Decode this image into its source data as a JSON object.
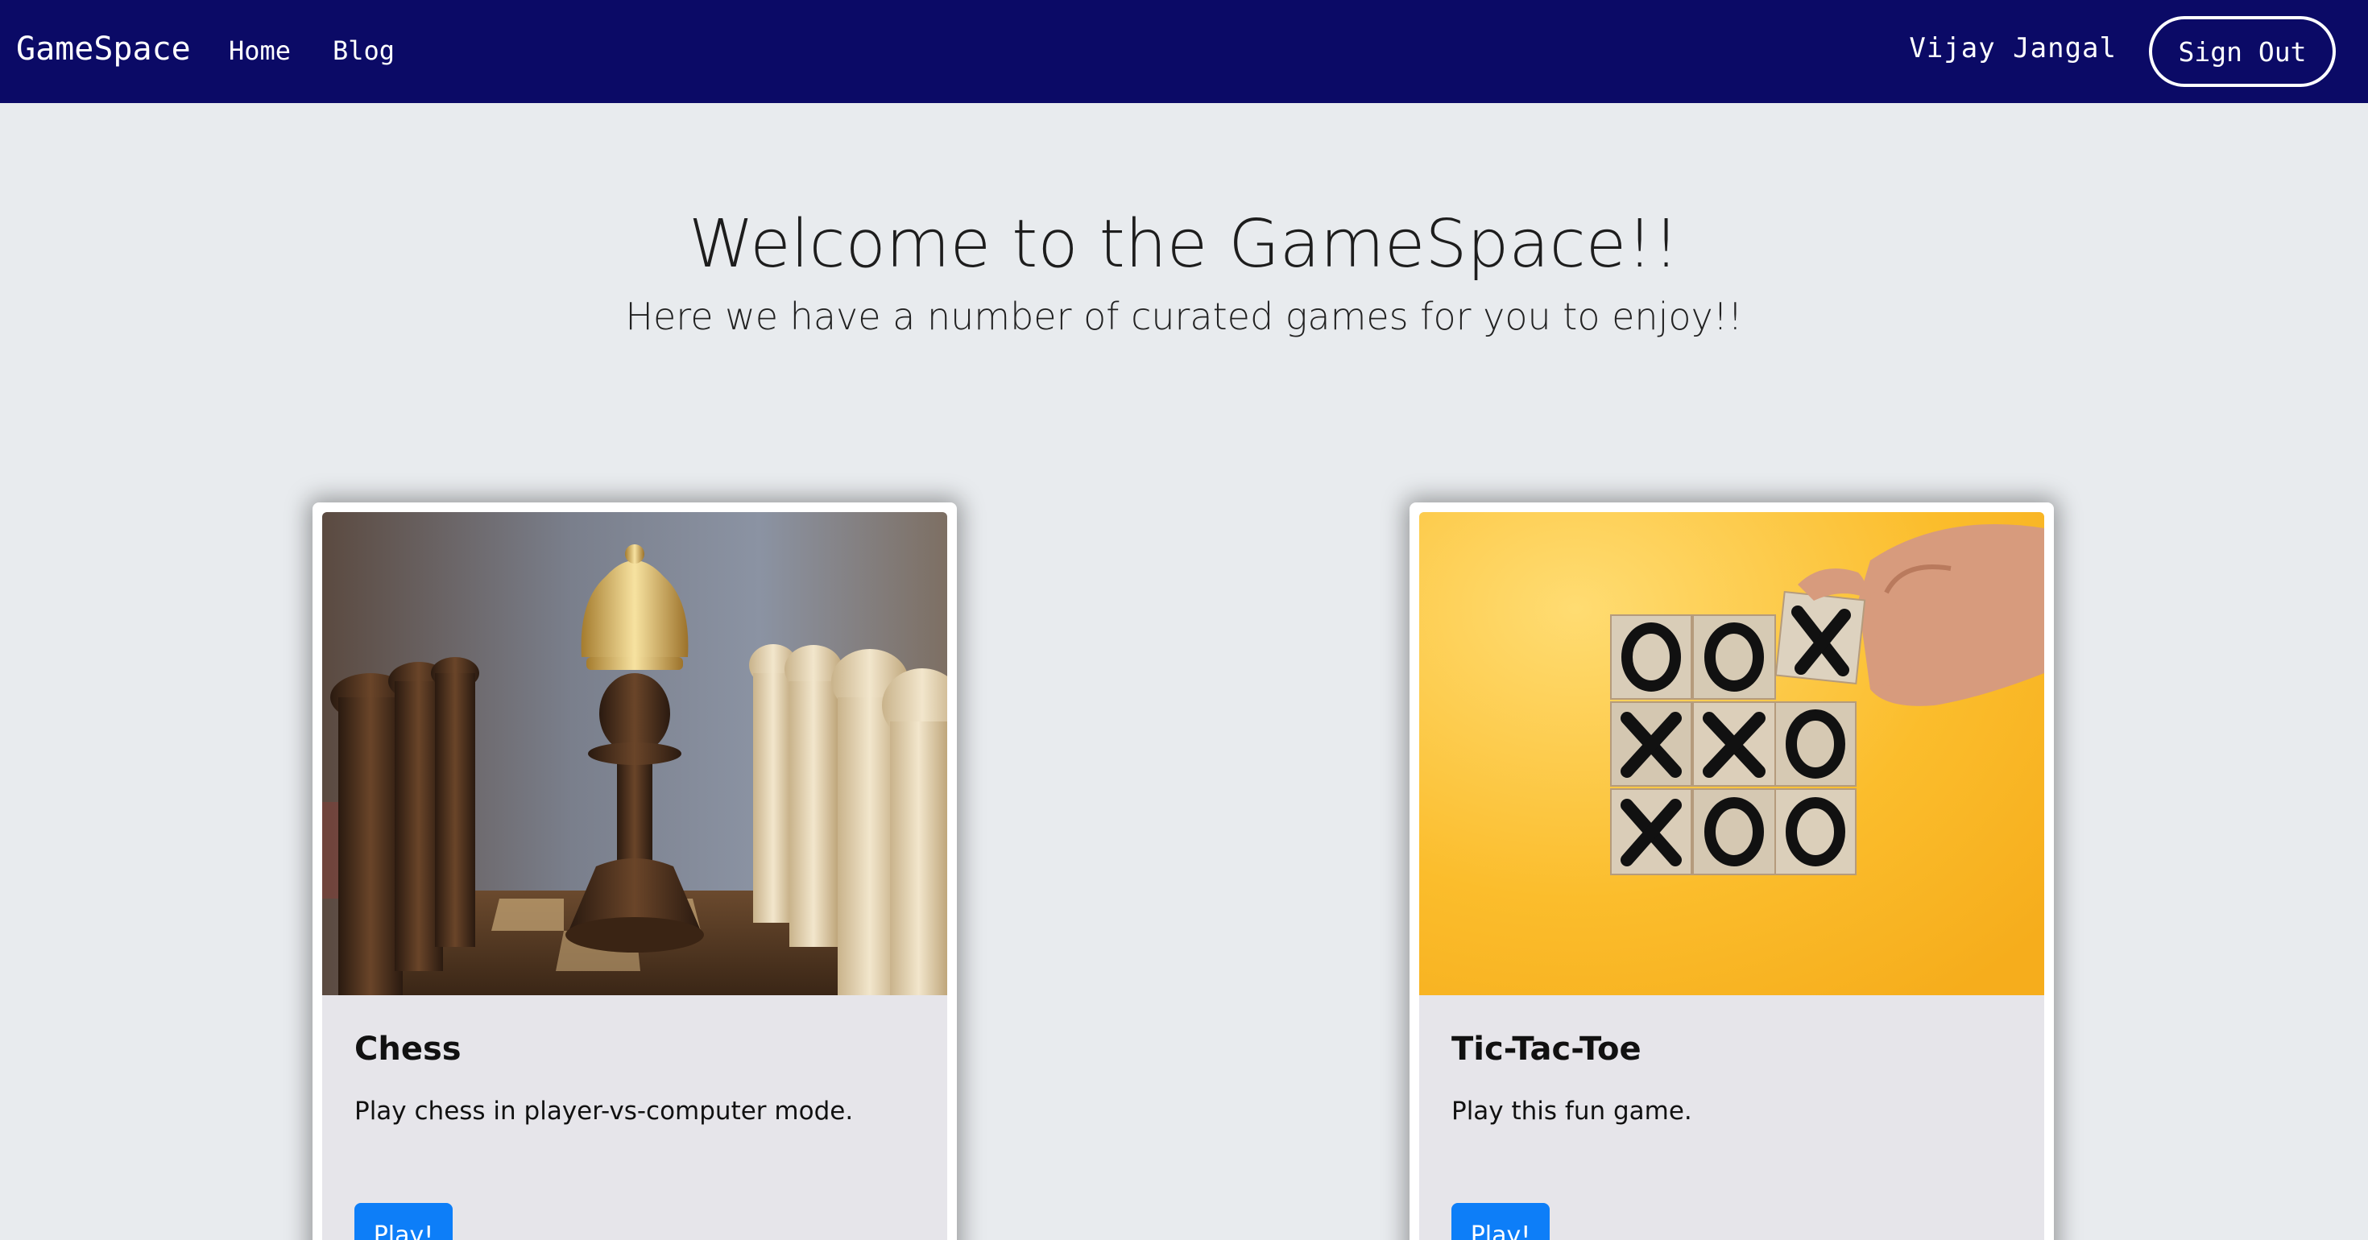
{
  "navbar": {
    "brand": "GameSpace",
    "links": [
      "Home",
      "Blog"
    ],
    "username": "Vijay Jangal",
    "signout_label": "Sign Out",
    "background": "#0b0a66"
  },
  "hero": {
    "title": "Welcome to the GameSpace!!",
    "subtitle": "Here we have a number of curated games for you to enjoy!!"
  },
  "cards": [
    {
      "title": "Chess",
      "text": "Play chess in player-vs-computer mode.",
      "button": "Play!",
      "image_icon": "chess-pawn-crown-image"
    },
    {
      "title": "Tic-Tac-Toe",
      "text": "Play this fun game.",
      "button": "Play!",
      "image_icon": "tic-tac-toe-blocks-image"
    }
  ],
  "colors": {
    "accent": "#0d7ef8",
    "page_bg": "#e8ebee"
  }
}
